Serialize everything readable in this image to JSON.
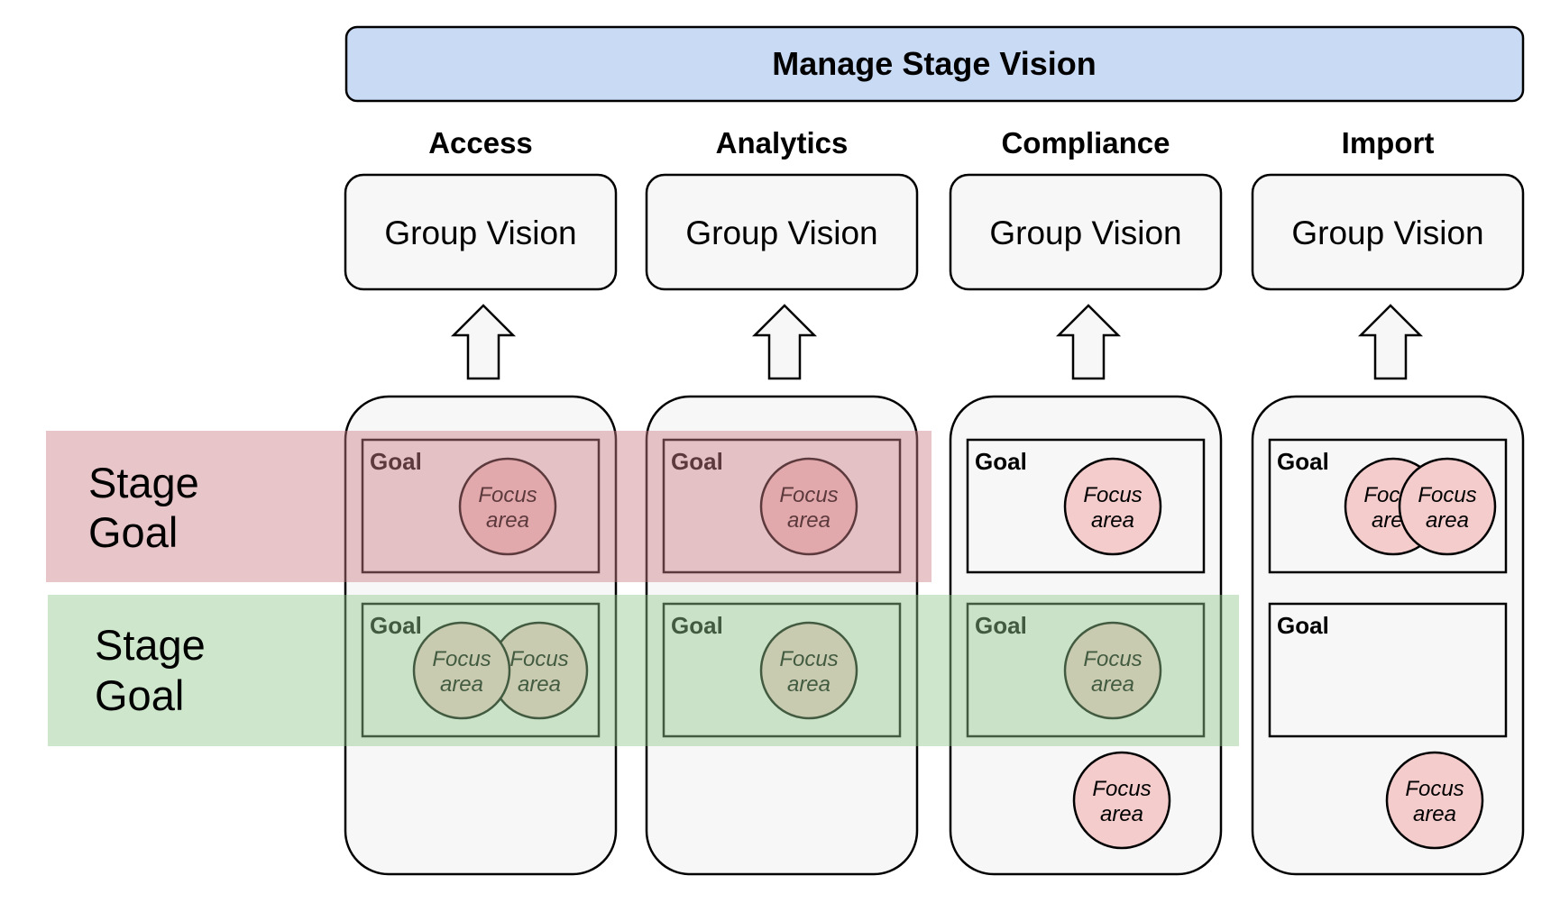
{
  "title": "Manage Stage Vision",
  "colors": {
    "title_fill": "#c9daf5",
    "box_fill": "#f7f7f7",
    "focus_fill": "#f4cccc",
    "stroke": "#000000",
    "red_band": "#cc7f85",
    "green_band": "#93c98e"
  },
  "columns": [
    {
      "name": "Access",
      "vision_label": "Group Vision",
      "goals": [
        {
          "label": "Goal",
          "focus_areas": [
            "Focus area"
          ]
        },
        {
          "label": "Goal",
          "focus_areas": [
            "Focus area",
            "Focus area"
          ]
        }
      ],
      "loose_focus_areas": []
    },
    {
      "name": "Analytics",
      "vision_label": "Group Vision",
      "goals": [
        {
          "label": "Goal",
          "focus_areas": [
            "Focus area"
          ]
        },
        {
          "label": "Goal",
          "focus_areas": [
            "Focus area"
          ]
        }
      ],
      "loose_focus_areas": []
    },
    {
      "name": "Compliance",
      "vision_label": "Group Vision",
      "goals": [
        {
          "label": "Goal",
          "focus_areas": [
            "Focus area"
          ]
        },
        {
          "label": "Goal",
          "focus_areas": [
            "Focus area"
          ]
        }
      ],
      "loose_focus_areas": [
        "Focus area"
      ]
    },
    {
      "name": "Import",
      "vision_label": "Group Vision",
      "goals": [
        {
          "label": "Goal",
          "focus_areas": [
            "Focus area",
            "Focus area"
          ]
        },
        {
          "label": "Goal",
          "focus_areas": []
        }
      ],
      "loose_focus_areas": [
        "Focus area"
      ]
    }
  ],
  "stage_bands": [
    {
      "label_line1": "Stage",
      "label_line2": "Goal",
      "color": "red",
      "spans_columns": [
        "Access",
        "Analytics"
      ]
    },
    {
      "label_line1": "Stage",
      "label_line2": "Goal",
      "color": "green",
      "spans_columns": [
        "Access",
        "Analytics",
        "Compliance"
      ]
    }
  ]
}
